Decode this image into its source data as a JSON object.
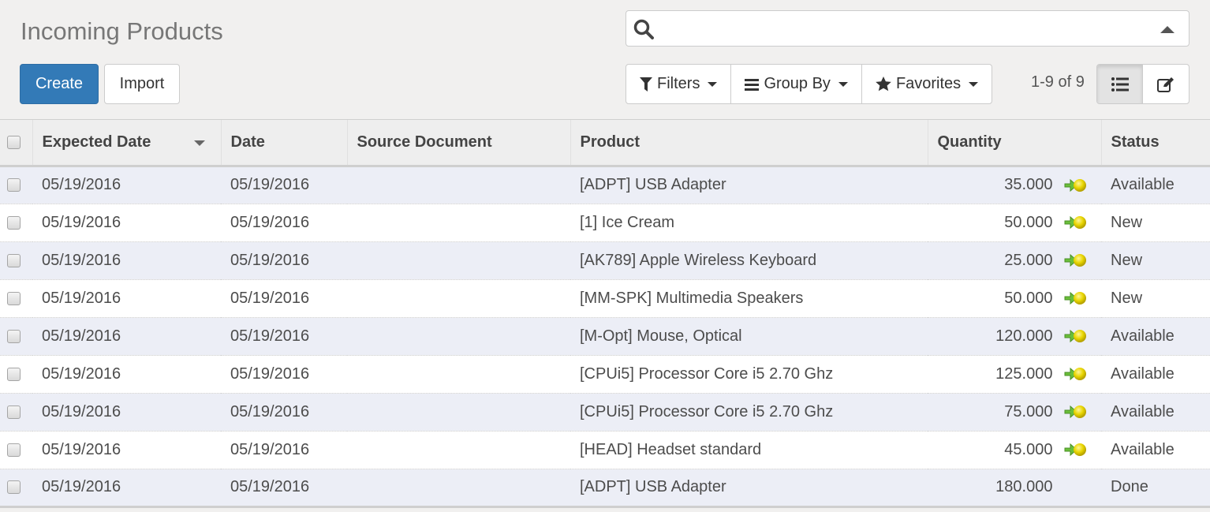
{
  "page": {
    "title": "Incoming Products"
  },
  "buttons": {
    "create": "Create",
    "import": "Import"
  },
  "search": {
    "value": "",
    "placeholder": ""
  },
  "search_options": {
    "filters": "Filters",
    "group_by": "Group By",
    "favorites": "Favorites"
  },
  "pager": {
    "text": "1-9 of 9"
  },
  "views": {
    "active": "list",
    "items": [
      "list",
      "form"
    ]
  },
  "table": {
    "columns": [
      "Expected Date",
      "Date",
      "Source Document",
      "Product",
      "Quantity",
      "Status"
    ],
    "sorted_column": "Expected Date",
    "sort_direction": "descending",
    "rows": [
      {
        "expected_date": "05/19/2016",
        "date": "05/19/2016",
        "source": "",
        "product": "[ADPT] USB Adapter",
        "quantity": "35.000",
        "has_icon": true,
        "status": "Available"
      },
      {
        "expected_date": "05/19/2016",
        "date": "05/19/2016",
        "source": "",
        "product": "[1] Ice Cream",
        "quantity": "50.000",
        "has_icon": true,
        "status": "New"
      },
      {
        "expected_date": "05/19/2016",
        "date": "05/19/2016",
        "source": "",
        "product": "[AK789] Apple Wireless Keyboard",
        "quantity": "25.000",
        "has_icon": true,
        "status": "New"
      },
      {
        "expected_date": "05/19/2016",
        "date": "05/19/2016",
        "source": "",
        "product": "[MM-SPK] Multimedia Speakers",
        "quantity": "50.000",
        "has_icon": true,
        "status": "New"
      },
      {
        "expected_date": "05/19/2016",
        "date": "05/19/2016",
        "source": "",
        "product": "[M-Opt] Mouse, Optical",
        "quantity": "120.000",
        "has_icon": true,
        "status": "Available"
      },
      {
        "expected_date": "05/19/2016",
        "date": "05/19/2016",
        "source": "",
        "product": "[CPUi5] Processor Core i5 2.70 Ghz",
        "quantity": "125.000",
        "has_icon": true,
        "status": "Available"
      },
      {
        "expected_date": "05/19/2016",
        "date": "05/19/2016",
        "source": "",
        "product": "[CPUi5] Processor Core i5 2.70 Ghz",
        "quantity": "75.000",
        "has_icon": true,
        "status": "Available"
      },
      {
        "expected_date": "05/19/2016",
        "date": "05/19/2016",
        "source": "",
        "product": "[HEAD] Headset standard",
        "quantity": "45.000",
        "has_icon": true,
        "status": "Available"
      },
      {
        "expected_date": "05/19/2016",
        "date": "05/19/2016",
        "source": "",
        "product": "[ADPT] USB Adapter",
        "quantity": "180.000",
        "has_icon": false,
        "status": "Done"
      }
    ]
  },
  "colors": {
    "primary": "#337ab7",
    "row_odd": "#eceef6",
    "row_even": "#ffffff",
    "background": "#f1f0ef"
  }
}
